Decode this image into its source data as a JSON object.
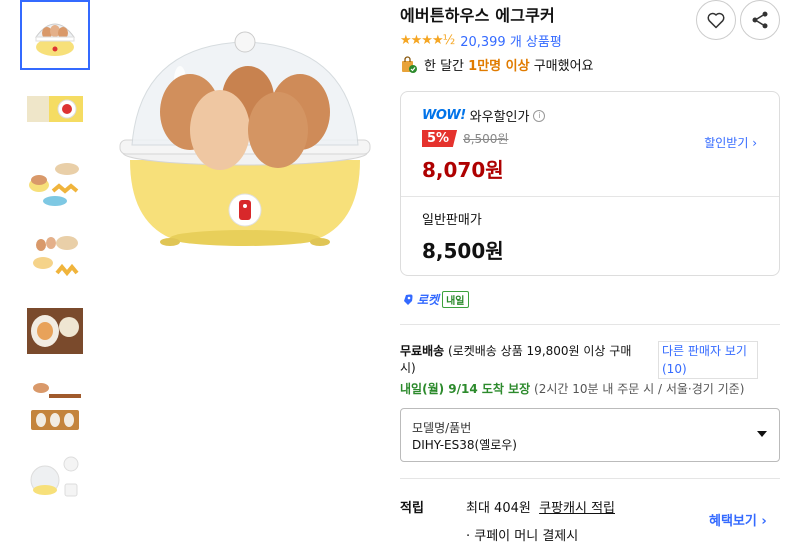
{
  "product": {
    "title": "에버튼하우스 에그쿠커",
    "rating_stars": "★★★★½",
    "review_count": "20,399 개 상품평",
    "popular_prefix": "한 달간",
    "popular_highlight": "1만명 이상",
    "popular_suffix": "구매했어요"
  },
  "wow": {
    "logo": "WOW!",
    "label": "와우할인가",
    "info_icon": "i",
    "discount_rate": "5%",
    "original_price": "8,500원",
    "price": "8,070원",
    "coupon_link": "할인받기 ›"
  },
  "normal": {
    "label": "일반판매가",
    "price": "8,500원"
  },
  "rocket": {
    "label": "로켓",
    "badge": "내일"
  },
  "shipping": {
    "free_label": "무료배송",
    "detail": "(로켓배송 상품 19,800원 이상 구매시)",
    "other_sellers": "다른 판매자 보기 (10)",
    "arrival": "내일(월) 9/14 도착 보장",
    "arrival_note": "(2시간 10분 내 주문 시 / 서울·경기 기준)"
  },
  "option": {
    "label": "모델명/품번",
    "value": "DIHY-ES38(옐로우)"
  },
  "points": {
    "label": "적립",
    "max_prefix": "최대 404원",
    "max_link": "쿠팡캐시 적립",
    "coupay": "· 쿠페이 머니 결제시",
    "benefits_link": "혜택보기 ›"
  },
  "colors": {
    "blue": "#346aff",
    "red": "#ae0000",
    "badge_red": "#e5322d",
    "green": "#2c8a2c",
    "yellow_body": "#f7e07a"
  },
  "icons": [
    "heart-icon",
    "share-icon",
    "popular-bag-icon",
    "rocket-icon",
    "caret-down-icon",
    "info-icon"
  ]
}
